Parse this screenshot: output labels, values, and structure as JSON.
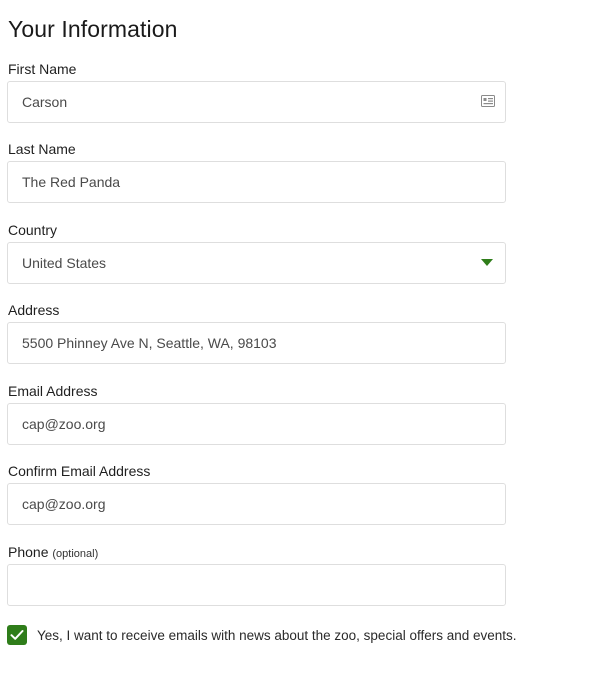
{
  "form": {
    "title": "Your Information",
    "first_name": {
      "label": "First Name",
      "value": "Carson",
      "icon": "contact-card-icon"
    },
    "last_name": {
      "label": "Last Name",
      "value": "The Red Panda"
    },
    "country": {
      "label": "Country",
      "value": "United States",
      "caret_color": "#2f7d1a"
    },
    "address": {
      "label": "Address",
      "value": "5500 Phinney Ave N, Seattle, WA, 98103"
    },
    "email": {
      "label": "Email Address",
      "value": "cap@zoo.org"
    },
    "confirm_email": {
      "label": "Confirm Email Address",
      "value": "cap@zoo.org"
    },
    "phone": {
      "label": "Phone",
      "optional_note": "(optional)",
      "value": ""
    },
    "newsletter": {
      "checked": true,
      "label": "Yes, I want to receive emails with news about the zoo, special offers and events.",
      "color": "#2f7d1a"
    }
  }
}
